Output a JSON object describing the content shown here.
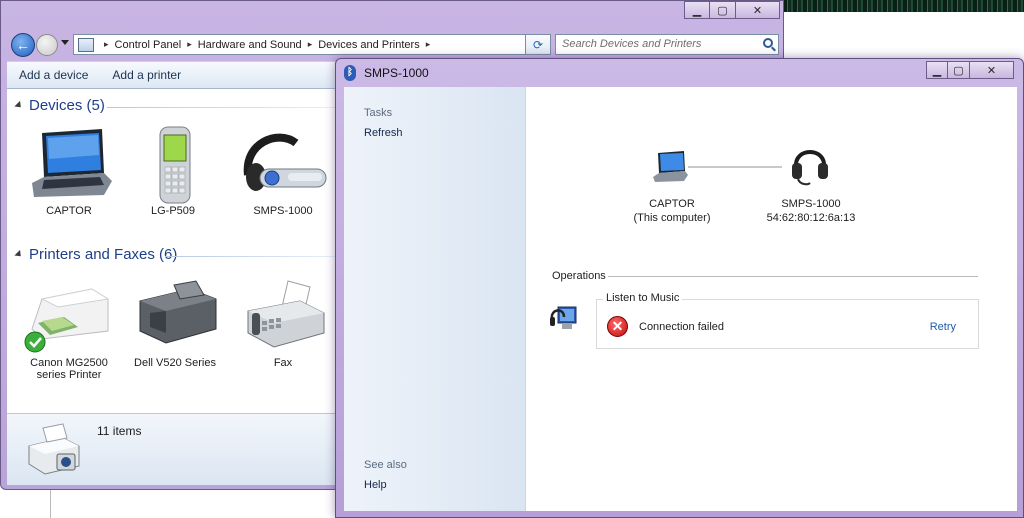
{
  "desktop": {},
  "explorer": {
    "nav": {
      "breadcrumb": [
        "Control Panel",
        "Hardware and Sound",
        "Devices and Printers"
      ],
      "search_placeholder": "Search Devices and Printers"
    },
    "toolbar": {
      "add_device": "Add a device",
      "add_printer": "Add a printer"
    },
    "groups": {
      "devices": {
        "header": "Devices (5)",
        "items": [
          {
            "label": "CAPTOR",
            "icon": "laptop-icon"
          },
          {
            "label": "LG-P509",
            "icon": "phone-icon"
          },
          {
            "label": "SMPS-1000",
            "icon": "headset-icon"
          }
        ]
      },
      "printers": {
        "header": "Printers and Faxes (6)",
        "items": [
          {
            "label": "Canon MG2500 series Printer",
            "icon": "printer-icon",
            "default": true
          },
          {
            "label": "Dell V520 Series",
            "icon": "printer-icon"
          },
          {
            "label": "Fax",
            "icon": "fax-icon"
          }
        ]
      }
    },
    "details": {
      "count": "11 items"
    }
  },
  "device_window": {
    "title": "SMPS-1000",
    "sidebar": {
      "tasks_header": "Tasks",
      "refresh": "Refresh",
      "see_also_header": "See also",
      "help": "Help"
    },
    "connection": {
      "computer_name": "CAPTOR",
      "computer_note": "(This computer)",
      "device_name": "SMPS-1000",
      "device_address": "54:62:80:12:6a:13"
    },
    "operations": {
      "header": "Operations",
      "items": [
        {
          "title": "Listen to Music",
          "status": "Connection failed",
          "action": "Retry"
        }
      ]
    },
    "colors": {
      "accent": "#1e3f8a",
      "error": "#c40b0b",
      "link": "#1f5aa8"
    }
  }
}
